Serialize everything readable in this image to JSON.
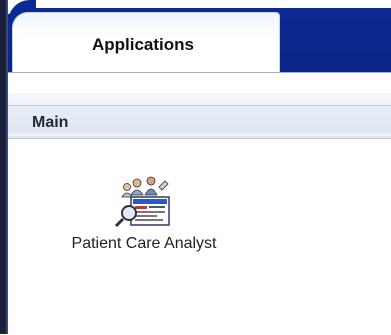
{
  "tabs": [
    {
      "label": "Applications",
      "selected": true
    }
  ],
  "section": {
    "title": "Main"
  },
  "apps": [
    {
      "label": "Patient Care Analyst",
      "icon": "patient-care-analyst-icon"
    }
  ],
  "colors": {
    "tab_strip": "#0d2a94",
    "frame": "#1a1f3a",
    "section_header": "#dde5f1"
  }
}
